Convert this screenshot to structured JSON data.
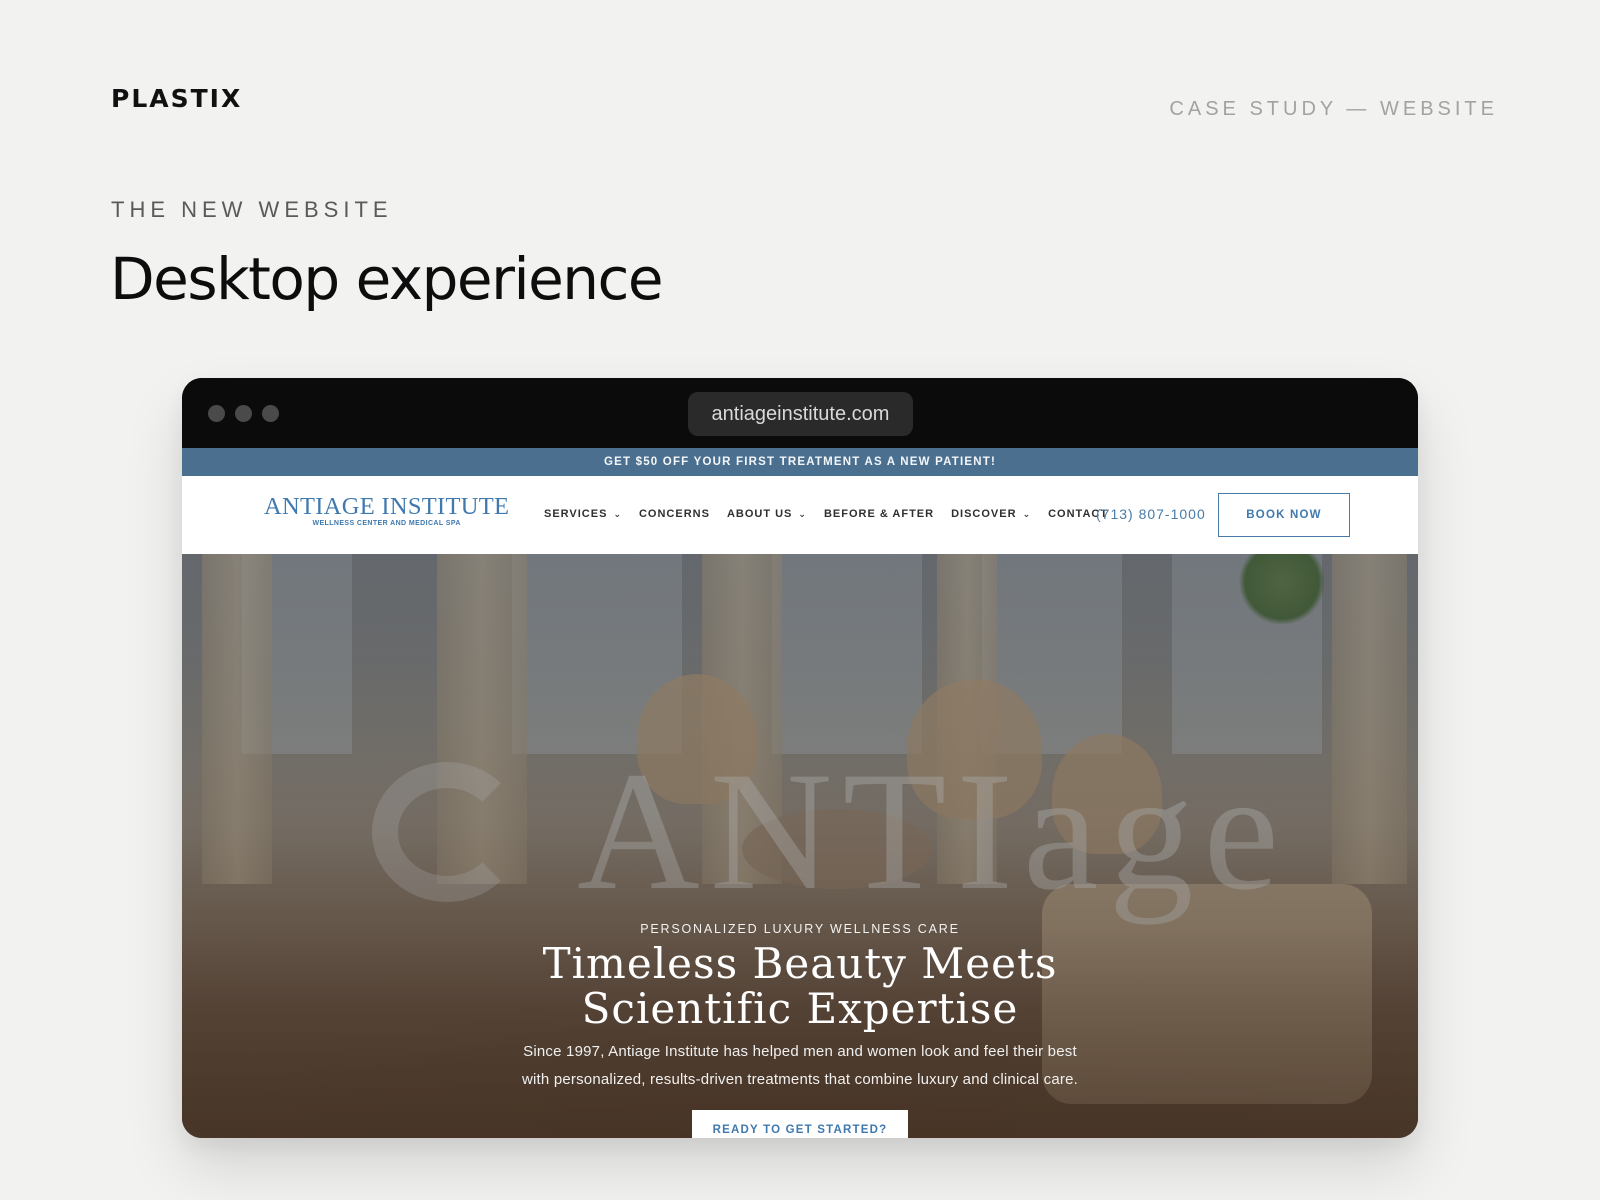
{
  "header": {
    "logo": "PLASTIX",
    "case_label": "CASE STUDY — WEBSITE"
  },
  "section": {
    "eyebrow": "THE NEW WEBSITE",
    "title": "Desktop experience"
  },
  "browser": {
    "url": "antiageinstitute.com"
  },
  "site": {
    "promo": "GET $50 OFF YOUR FIRST TREATMENT AS A NEW PATIENT!",
    "logo_name": "ANTIAGE INSTITUTE",
    "logo_tagline": "WELLNESS CENTER AND MEDICAL SPA",
    "nav": [
      {
        "label": "SERVICES",
        "has_dropdown": true
      },
      {
        "label": "CONCERNS",
        "has_dropdown": false
      },
      {
        "label": "ABOUT US",
        "has_dropdown": true
      },
      {
        "label": "BEFORE & AFTER",
        "has_dropdown": false
      },
      {
        "label": "DISCOVER",
        "has_dropdown": true
      },
      {
        "label": "CONTACT",
        "has_dropdown": false
      }
    ],
    "phone": "(713) 807-1000",
    "book_label": "BOOK NOW",
    "hero": {
      "eyebrow": "PERSONALIZED LUXURY WELLNESS CARE",
      "title_line1": "Timeless Beauty Meets",
      "title_line2": "Scientific Expertise",
      "body_line1": "Since 1997, Antiage Institute has helped men and women look and feel their best",
      "body_line2": "with personalized, results-driven treatments that combine luxury and clinical care.",
      "cta": "READY TO GET STARTED?"
    }
  },
  "colors": {
    "page_bg": "#f2f2f0",
    "browser_chrome": "#0b0b0b",
    "promo_bar": "#4b6f8f",
    "brand_blue": "#3f79ad"
  }
}
